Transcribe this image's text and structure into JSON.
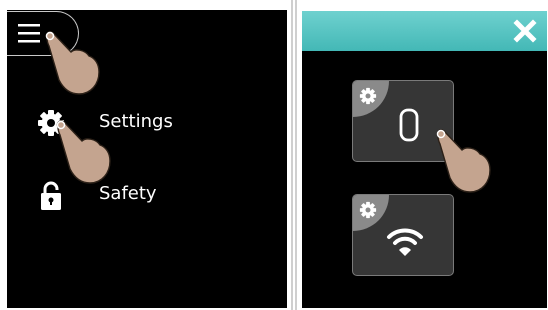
{
  "left_panel": {
    "menu_items": [
      {
        "label": "Settings",
        "icon": "gear-icon"
      },
      {
        "label": "Safety",
        "icon": "lock-icon"
      }
    ],
    "menu_button_icon": "hamburger-menu-icon",
    "gesture_icon": "pointing-hand-icon"
  },
  "right_panel": {
    "header_color": "#4ec3c1",
    "close_icon": "close-icon",
    "tiles": [
      {
        "icon": "watch-strap-icon",
        "badge_icon": "gear-icon"
      },
      {
        "icon": "wifi-icon",
        "badge_icon": "gear-icon"
      }
    ]
  },
  "colors": {
    "background": "#000000",
    "tile_background": "#363636",
    "tile_badge": "#8a8a8a",
    "text": "#ffffff",
    "hand": "#c4a48f"
  }
}
